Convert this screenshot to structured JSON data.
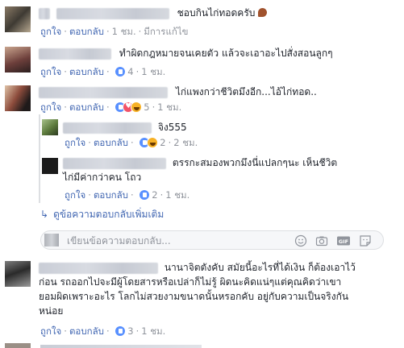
{
  "meta": {
    "like": "ถูกใจ",
    "reply": "ตอบกลับ",
    "sep": "·",
    "edited": "มีการแก้ไข"
  },
  "comments": [
    {
      "text": "ชอบกินไก่ทอดครับ",
      "time": "1 ชม.",
      "reaction_count": ""
    },
    {
      "text": "ทำผิดกฎหมายจนเคยตัว แล้วจะเอาอะไปสั่งสอนลูกๆ",
      "time": "1 ชม.",
      "reaction_count": "4"
    },
    {
      "text": "ไก่แพงกว่าชีวิตมึงอีก...ไอ้ไก่ทอด..",
      "time": "1 ชม.",
      "reaction_count": "5"
    }
  ],
  "replies": [
    {
      "text": "จิง555",
      "time": "2 ชม.",
      "reaction_count": "2"
    },
    {
      "text_line1": "ตรรกะสมองพวกมึงนี่แปลกๆนะ เห็นชีวิต",
      "text_line2": "ไก่มีค่ากว่าคน โถว",
      "time": "1 ชม.",
      "reaction_count": "2"
    }
  ],
  "more_replies": "ดูข้อความตอบกลับเพิ่มเติม",
  "reply_box": {
    "placeholder": "เขียนข้อความตอบกลับ..."
  },
  "bottom_comment": {
    "line1": "นานาจิตตังคับ สมัยนี้อะไรที่ได้เงิน ก็ต้องเอาไว้",
    "line2": "ก่อน รถออกไปจะมีผู้โดยสารหรือเปล่าก็ไม่รู้ ผิดนะคิดแน่ๆแต่คุณคิดว่าเขา",
    "line3": "ยอมผิดเพราะอะไร โลกไม่สวยงามขนาดนั้นหรอกคับ อยู่กับความเป็นจริงกัน",
    "line4": "หน่อย",
    "time": "1 ชม.",
    "reaction_count": "3"
  },
  "colors": {
    "link": "#4267b2",
    "meta": "#90949c",
    "text": "#1d2129",
    "like": "#5890ff"
  },
  "icons": [
    "thread-arrow-icon",
    "emoji-icon",
    "camera-icon",
    "gif-icon",
    "sticker-icon"
  ]
}
